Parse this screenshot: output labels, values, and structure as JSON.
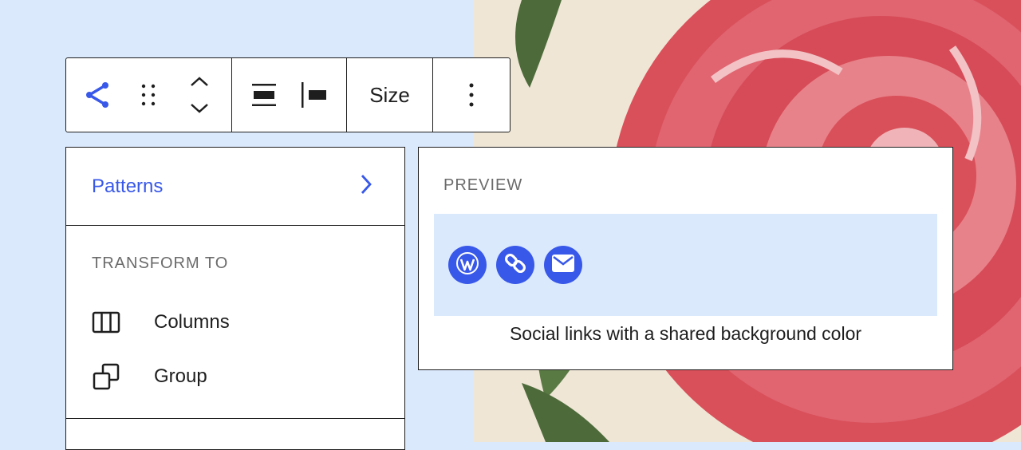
{
  "toolbar": {
    "share_icon": "share-icon",
    "drag_icon": "drag-handle-icon",
    "move_up_icon": "chevron-up-icon",
    "move_down_icon": "chevron-down-icon",
    "justify_icon": "justify-space-between-icon",
    "justify_left_icon": "justify-left-icon",
    "size_label": "Size",
    "more_icon": "more-vertical-icon"
  },
  "menu": {
    "patterns_label": "Patterns",
    "transform_heading": "TRANSFORM TO",
    "items": [
      {
        "label": "Columns",
        "icon": "columns-icon"
      },
      {
        "label": "Group",
        "icon": "group-icon"
      }
    ]
  },
  "preview": {
    "heading": "PREVIEW",
    "caption": "Social links with a shared background color",
    "icons": [
      "wordpress-icon",
      "link-icon",
      "mail-icon"
    ]
  },
  "colors": {
    "accent": "#3858e9",
    "background": "#dbe9fd",
    "border": "#1e1e1e",
    "muted_text": "#6b6b6b"
  }
}
